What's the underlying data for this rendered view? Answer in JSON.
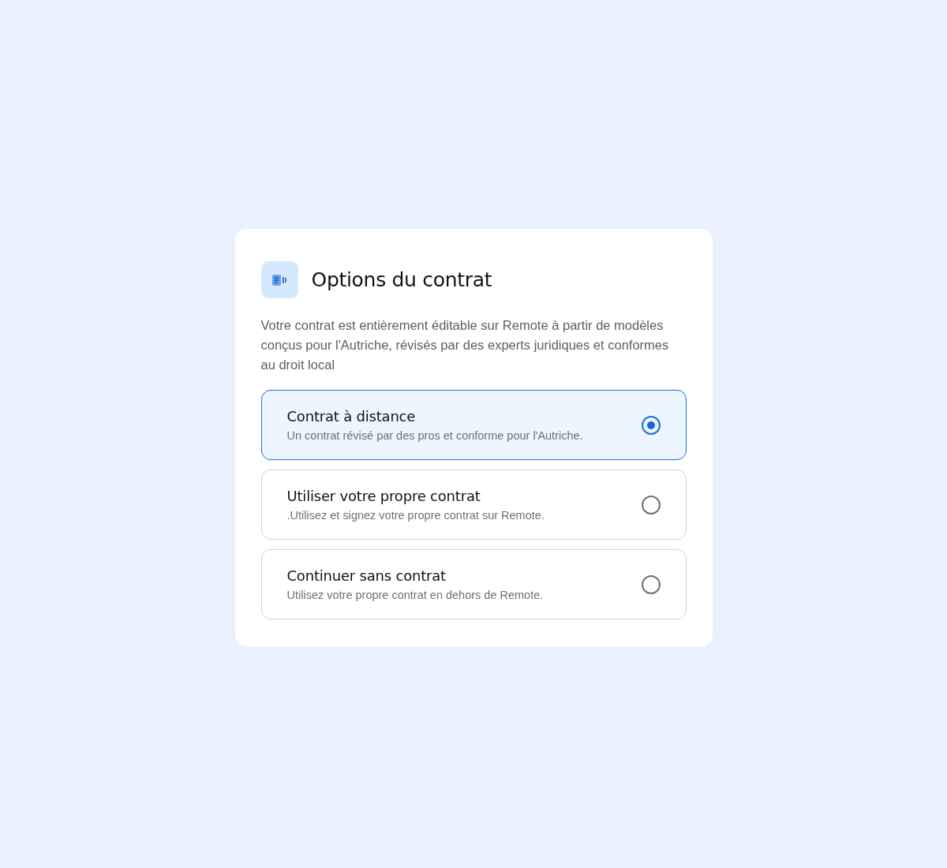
{
  "card": {
    "title": "Options du contrat",
    "description": "Votre contrat est entièrement éditable sur Remote à partir de modèles conçus pour l'Autriche, révisés par des experts juridiques et conformes au droit local"
  },
  "options": [
    {
      "title": "Contrat à distance",
      "subtitle": "Un contrat révisé par des pros et conforme pour l'Autriche.",
      "selected": true
    },
    {
      "title": "Utiliser votre propre contrat",
      "subtitle": ".Utilisez et signez votre propre contrat sur Remote.",
      "selected": false
    },
    {
      "title": "Continuer sans contrat",
      "subtitle": "Utilisez votre propre contrat en dehors de Remote.",
      "selected": false
    }
  ]
}
